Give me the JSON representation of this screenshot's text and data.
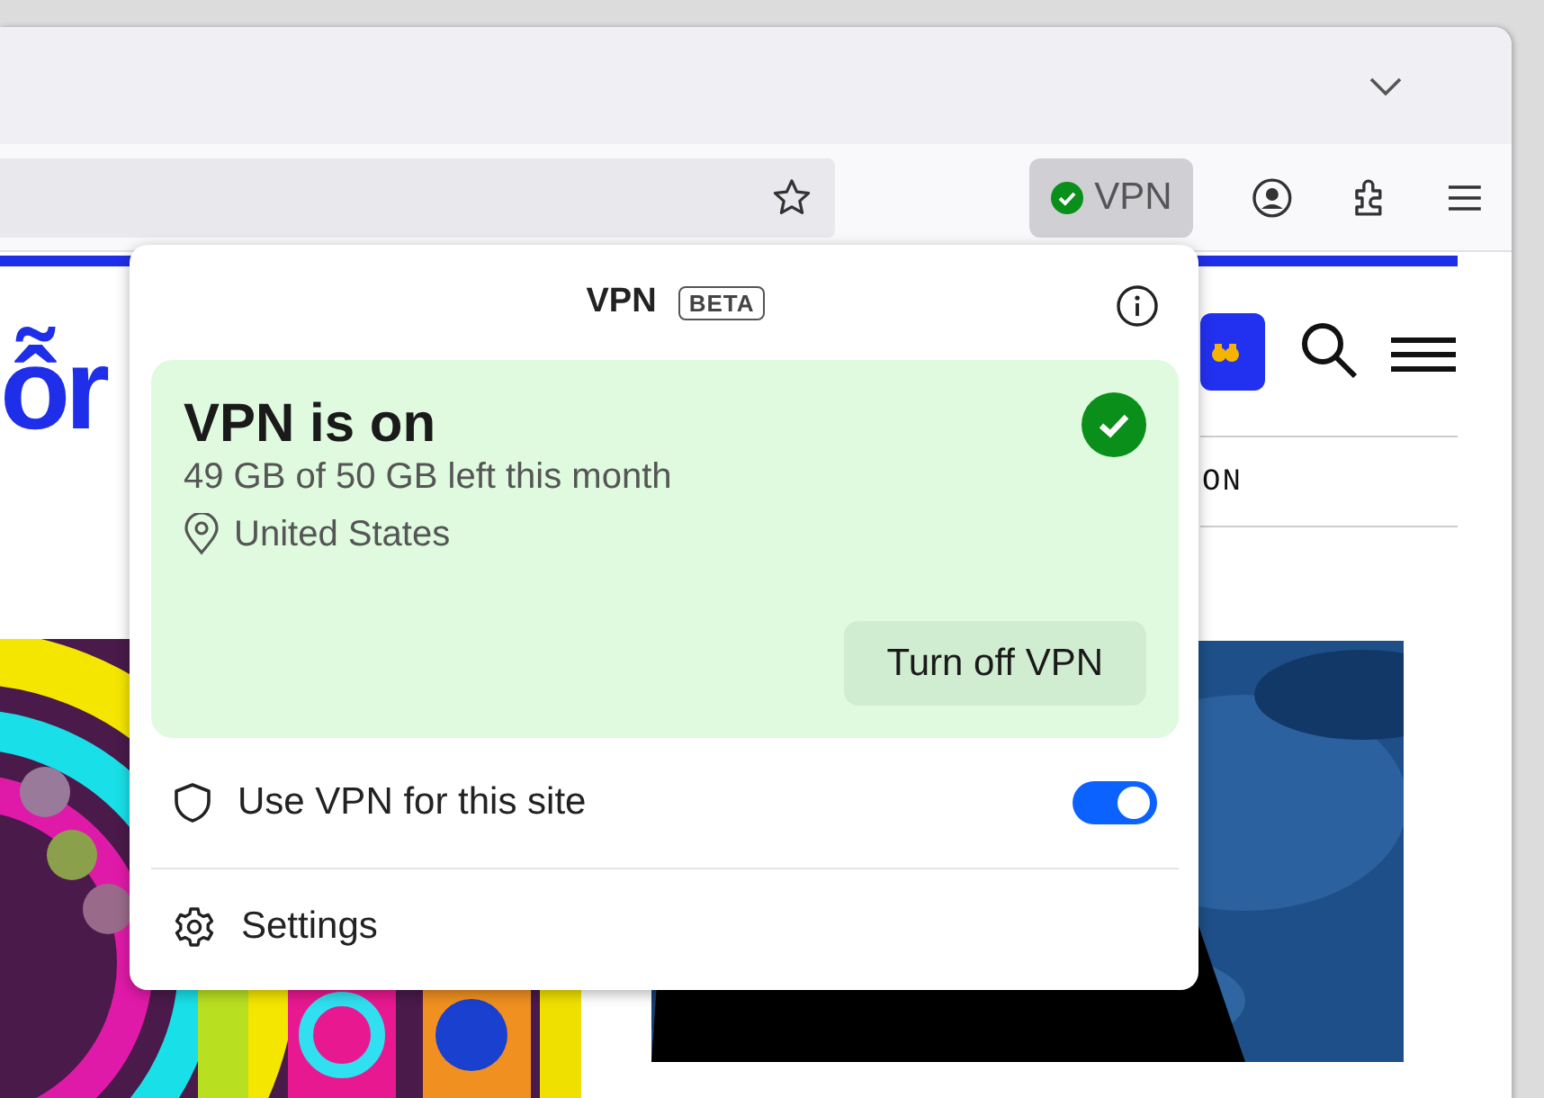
{
  "toolbar": {
    "vpn_button": {
      "label": "VPN",
      "connected": true
    }
  },
  "page": {
    "logo_text": "ỗr",
    "nav_text": "ON"
  },
  "popup": {
    "title": "VPN",
    "badge": "BETA",
    "status": {
      "title": "VPN is on",
      "usage": "49 GB of 50 GB left this month",
      "location": "United States",
      "connected": true,
      "button": "Turn off VPN"
    },
    "site_toggle": {
      "label": "Use VPN for this site",
      "on": true
    },
    "settings": {
      "label": "Settings"
    }
  }
}
